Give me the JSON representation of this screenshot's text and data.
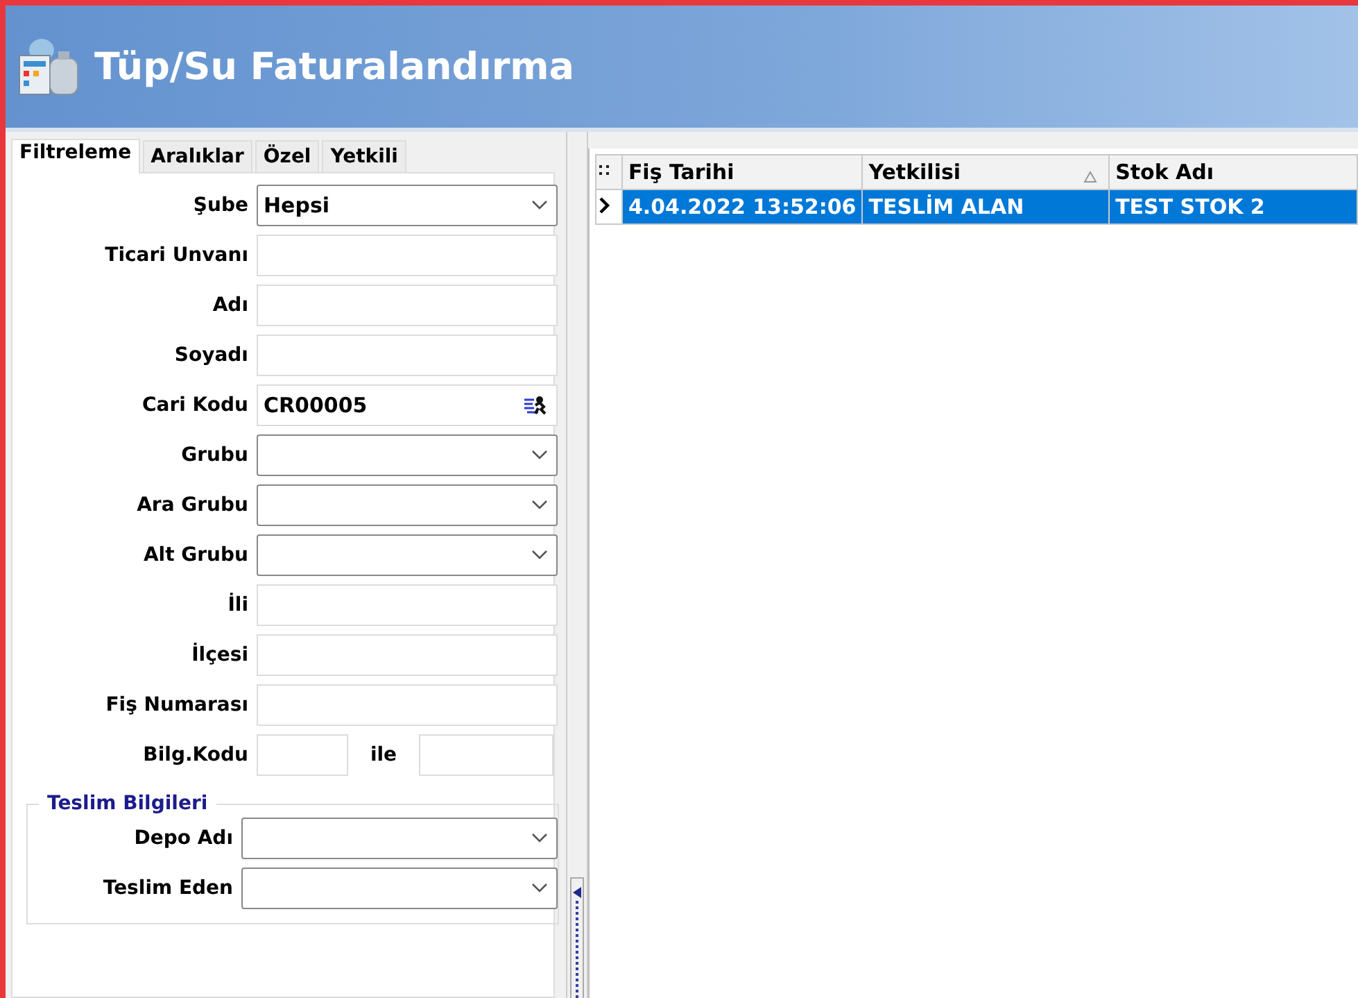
{
  "window": {
    "title": "Tüp/Su Faturalandırma"
  },
  "tabs": [
    {
      "label": "Filtreleme",
      "selected": true
    },
    {
      "label": "Aralıklar",
      "selected": false
    },
    {
      "label": "Özel",
      "selected": false
    },
    {
      "label": "Yetkili",
      "selected": false
    }
  ],
  "filters": [
    {
      "kind": "select",
      "label": "Şube",
      "value": "Hepsi"
    },
    {
      "kind": "text",
      "label": "Ticari Unvanı"
    },
    {
      "kind": "text",
      "label": "Adı"
    },
    {
      "kind": "text",
      "label": "Soyadı"
    },
    {
      "kind": "lookup",
      "label": "Cari Kodu",
      "value": "CR00005"
    },
    {
      "kind": "select",
      "label": "Grubu"
    },
    {
      "kind": "select",
      "label": "Ara Grubu"
    },
    {
      "kind": "select",
      "label": "Alt Grubu"
    },
    {
      "kind": "text",
      "label": "İli"
    },
    {
      "kind": "text",
      "label": "İlçesi"
    },
    {
      "kind": "text",
      "label": "Fiş Numarası"
    },
    {
      "kind": "range",
      "label": "Bilg.Kodu",
      "joiner": "ile"
    }
  ],
  "delivery_group": {
    "title": "Teslim Bilgileri",
    "fields": [
      {
        "kind": "select",
        "label": "Depo Adı"
      },
      {
        "kind": "select",
        "label": "Teslim Eden"
      }
    ]
  },
  "table": {
    "columns": [
      {
        "label": "Fiş Tarihi",
        "sorted": false
      },
      {
        "label": "Yetkilisi",
        "sorted": true
      },
      {
        "label": "Stok Adı",
        "sorted": false
      }
    ],
    "rows": [
      {
        "selected": true,
        "cells": [
          "4.04.2022 13:52:06",
          "TESLİM ALAN",
          "TEST STOK 2"
        ]
      }
    ]
  }
}
